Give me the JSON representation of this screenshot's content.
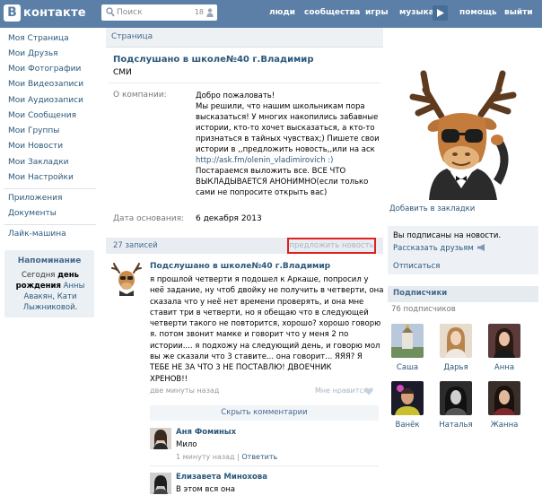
{
  "header": {
    "logo_letter": "В",
    "logo_text": "контакте",
    "search_placeholder": "Поиск",
    "search_count": "18",
    "nav": [
      "люди",
      "сообщества",
      "игры",
      "музыка",
      "помощь",
      "выйти"
    ]
  },
  "leftmenu": {
    "items": [
      "Моя Страница",
      "Мои Друзья",
      "Мои Фотографии",
      "Мои Видеозаписи",
      "Мои Аудиозаписи",
      "Мои Сообщения",
      "Мои Группы",
      "Мои Новости",
      "Мои Закладки",
      "Мои Настройки"
    ],
    "apps": "Приложения",
    "docs": "Документы",
    "likemachine": "Лайк-машина"
  },
  "reminder": {
    "title": "Напоминание",
    "today": "Сегодня ",
    "bday": "день рождения",
    "names_a": " Анны Авакян",
    "comma": ", ",
    "names_b": "Кати Лыжниковой",
    "dot": "."
  },
  "page": {
    "section": "Страница",
    "name": "Подслушано в школе№40 г.Владимир",
    "subtitle": "СМИ",
    "about_label": "О компании:",
    "about_lines": [
      "Добро пожаловать!",
      "Мы решили, что нашим школьникам пора",
      "высказаться! У многих накопились забавные",
      "истории, кто-то хочет высказаться, а кто-то",
      "признаться в тайных чувствах;) Пишете свои",
      "истории в ,,предложить новость,,или на аск",
      "http://ask.fm/olenin_vladimirovich :)",
      "Постараемся выложить все. ВСЕ ЧТО",
      "ВЫКЛАДЫВАЕТСЯ АНОНИМНО(если только",
      "сами не попросите открыть вас)"
    ],
    "founded_label": "Дата основания:",
    "founded_value": "6 декабря 2013"
  },
  "wall": {
    "count": "27 записей",
    "suggest": "предложить новость"
  },
  "post": {
    "author": "Подслушано в школе№40 г.Владимир",
    "lines": [
      "я прошлой четверти я подошел к Аркаше, попросил у",
      "неё задание, ну чтоб двойку не получить в четверти, она",
      "сказала что у неё нет времени проверять, и она мне",
      "ставит три в четверти, но я обещаю что в следующей",
      "четверти такого не повторится, хорошо? хорошо говорю",
      "я. потом звонит мамке и говорит что у меня 2 по",
      "истории.... я подхожу на следующий день, и говорю мол",
      "вы же сказали что 3 ставите... она говорит... ЯЯЯ? Я",
      "ТЕБЕ НЕ ЗА ЧТО 3 НЕ ПОСТАВЛЮ! ДВОЕЧНИК",
      "ХРЕНОВ!!"
    ],
    "time": "две минуты назад",
    "like": "Мне нравится",
    "hide_comments": "Скрыть комментарии"
  },
  "comments": [
    {
      "name": "Аня Фоминых",
      "text": "Мило",
      "time": "1 минуту назад",
      "sep": " | ",
      "reply": "Ответить"
    },
    {
      "name": "Елизавета Минохова",
      "text": "В этом вся она",
      "time": "",
      "sep": "",
      "reply": ""
    }
  ],
  "right": {
    "bookmark": "Добавить в закладки",
    "subscribed": "Вы подписаны на новости.",
    "tell_friends": "Рассказать друзьям",
    "unsubscribe": "Отписаться",
    "members_title": "Подписчики",
    "members_count": "76 подписчиков",
    "members": [
      "Саша",
      "Дарья",
      "Анна",
      "Ванёк",
      "Наталья",
      "Жанна"
    ]
  }
}
